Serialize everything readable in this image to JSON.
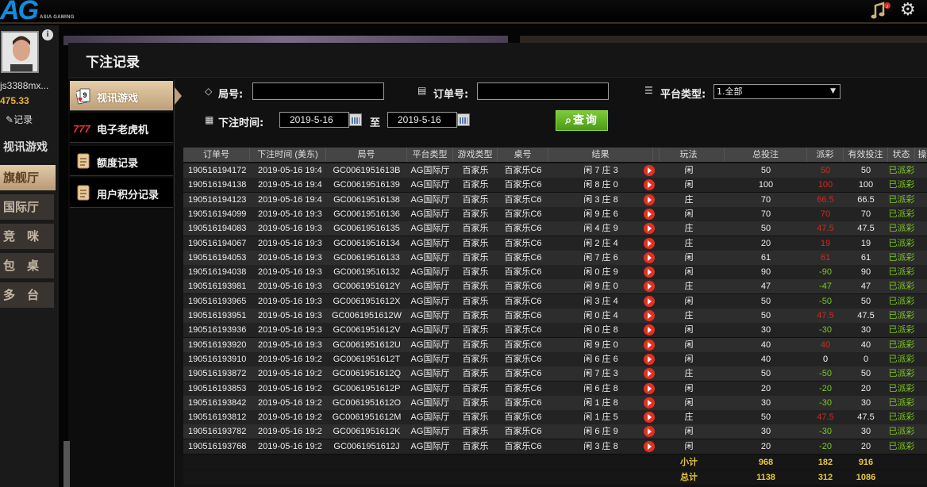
{
  "topbar": {
    "logo_text": "AG",
    "logo_sub": "ASIA GAMING"
  },
  "left_panel": {
    "username": "js3388mx...",
    "balance": "475.33",
    "record_link": "记录",
    "nav": [
      {
        "label": "视讯游戏"
      },
      {
        "label": "旗舰厅"
      },
      {
        "label": "国际厅"
      },
      {
        "label": "竞　咪"
      },
      {
        "label": "包　桌"
      },
      {
        "label": "多　台"
      }
    ]
  },
  "modal": {
    "title": "下注记录",
    "tabs": [
      {
        "label": "视讯游戏"
      },
      {
        "label": "电子老虎机"
      },
      {
        "label": "额度记录"
      },
      {
        "label": "用户积分记录"
      }
    ],
    "filters": {
      "round_label": "局号:",
      "order_label": "订单号:",
      "platform_label": "平台类型:",
      "platform_value": "1.全部",
      "time_label": "下注时间:",
      "date_from": "2019-5-16",
      "to_label": "至",
      "date_to": "2019-5-16",
      "query_label": "查询"
    },
    "table": {
      "headers": [
        "订单号",
        "下注时间 (美东)",
        "局号",
        "平台类型",
        "游戏类型",
        "桌号",
        "结果",
        "",
        "玩法",
        "总投注",
        "派彩",
        "有效投注",
        "状态",
        "操作"
      ],
      "rows": [
        [
          "190516194172",
          "2019-05-16 19:4",
          "GC0061951613B",
          "AG国际厅",
          "百家乐",
          "百家乐C6",
          "闲 7 庄 3",
          "闲",
          "50",
          "50",
          "50",
          "已派彩"
        ],
        [
          "190516194138",
          "2019-05-16 19:4",
          "GC00619516139",
          "AG国际厅",
          "百家乐",
          "百家乐C6",
          "闲 8 庄 0",
          "闲",
          "100",
          "100",
          "100",
          "已派彩"
        ],
        [
          "190516194123",
          "2019-05-16 19:4",
          "GC00619516138",
          "AG国际厅",
          "百家乐",
          "百家乐C6",
          "闲 3 庄 8",
          "庄",
          "70",
          "66.5",
          "66.5",
          "已派彩"
        ],
        [
          "190516194099",
          "2019-05-16 19:3",
          "GC00619516136",
          "AG国际厅",
          "百家乐",
          "百家乐C6",
          "闲 9 庄 6",
          "闲",
          "70",
          "70",
          "70",
          "已派彩"
        ],
        [
          "190516194083",
          "2019-05-16 19:3",
          "GC00619516135",
          "AG国际厅",
          "百家乐",
          "百家乐C6",
          "闲 4 庄 9",
          "庄",
          "50",
          "47.5",
          "47.5",
          "已派彩"
        ],
        [
          "190516194067",
          "2019-05-16 19:3",
          "GC00619516134",
          "AG国际厅",
          "百家乐",
          "百家乐C6",
          "闲 2 庄 4",
          "庄",
          "20",
          "19",
          "19",
          "已派彩"
        ],
        [
          "190516194053",
          "2019-05-16 19:3",
          "GC00619516133",
          "AG国际厅",
          "百家乐",
          "百家乐C6",
          "闲 7 庄 6",
          "闲",
          "61",
          "61",
          "61",
          "已派彩"
        ],
        [
          "190516194038",
          "2019-05-16 19:3",
          "GC00619516132",
          "AG国际厅",
          "百家乐",
          "百家乐C6",
          "闲 0 庄 9",
          "闲",
          "90",
          "-90",
          "90",
          "已派彩"
        ],
        [
          "190516193981",
          "2019-05-16 19:3",
          "GC0061951612Y",
          "AG国际厅",
          "百家乐",
          "百家乐C6",
          "闲 9 庄 0",
          "庄",
          "47",
          "-47",
          "47",
          "已派彩"
        ],
        [
          "190516193965",
          "2019-05-16 19:3",
          "GC0061951612X",
          "AG国际厅",
          "百家乐",
          "百家乐C6",
          "闲 3 庄 4",
          "闲",
          "50",
          "-50",
          "50",
          "已派彩"
        ],
        [
          "190516193951",
          "2019-05-16 19:3",
          "GC0061951612W",
          "AG国际厅",
          "百家乐",
          "百家乐C6",
          "闲 0 庄 4",
          "庄",
          "50",
          "47.5",
          "47.5",
          "已派彩"
        ],
        [
          "190516193936",
          "2019-05-16 19:3",
          "GC0061951612V",
          "AG国际厅",
          "百家乐",
          "百家乐C6",
          "闲 0 庄 8",
          "闲",
          "30",
          "-30",
          "30",
          "已派彩"
        ],
        [
          "190516193920",
          "2019-05-16 19:3",
          "GC0061951612U",
          "AG国际厅",
          "百家乐",
          "百家乐C6",
          "闲 9 庄 0",
          "闲",
          "40",
          "40",
          "40",
          "已派彩"
        ],
        [
          "190516193910",
          "2019-05-16 19:2",
          "GC0061951612T",
          "AG国际厅",
          "百家乐",
          "百家乐C6",
          "闲 6 庄 6",
          "闲",
          "40",
          "0",
          "0",
          "已派彩"
        ],
        [
          "190516193872",
          "2019-05-16 19:2",
          "GC0061951612Q",
          "AG国际厅",
          "百家乐",
          "百家乐C6",
          "闲 7 庄 3",
          "庄",
          "50",
          "-50",
          "50",
          "已派彩"
        ],
        [
          "190516193853",
          "2019-05-16 19:2",
          "GC0061951612P",
          "AG国际厅",
          "百家乐",
          "百家乐C6",
          "闲 6 庄 8",
          "闲",
          "20",
          "-20",
          "20",
          "已派彩"
        ],
        [
          "190516193842",
          "2019-05-16 19:2",
          "GC0061951612O",
          "AG国际厅",
          "百家乐",
          "百家乐C6",
          "闲 1 庄 8",
          "闲",
          "30",
          "-30",
          "30",
          "已派彩"
        ],
        [
          "190516193812",
          "2019-05-16 19:2",
          "GC0061951612M",
          "AG国际厅",
          "百家乐",
          "百家乐C6",
          "闲 1 庄 5",
          "庄",
          "50",
          "47.5",
          "47.5",
          "已派彩"
        ],
        [
          "190516193782",
          "2019-05-16 19:2",
          "GC0061951612K",
          "AG国际厅",
          "百家乐",
          "百家乐C6",
          "闲 6 庄 9",
          "闲",
          "30",
          "-30",
          "30",
          "已派彩"
        ],
        [
          "190516193768",
          "2019-05-16 19:2",
          "GC0061951612J",
          "AG国际厅",
          "百家乐",
          "百家乐C6",
          "闲 3 庄 8",
          "闲",
          "20",
          "-20",
          "20",
          "已派彩"
        ]
      ],
      "subtotal": {
        "label": "小计",
        "total_bet": "968",
        "payout": "182",
        "valid_bet": "916"
      },
      "total": {
        "label": "总计",
        "total_bet": "1138",
        "payout": "312",
        "valid_bet": "1086"
      }
    }
  },
  "colors": {
    "accent": "#bda07a",
    "positive": "#d22a1e",
    "negative": "#7ec81e",
    "status": "#7ec81e"
  }
}
